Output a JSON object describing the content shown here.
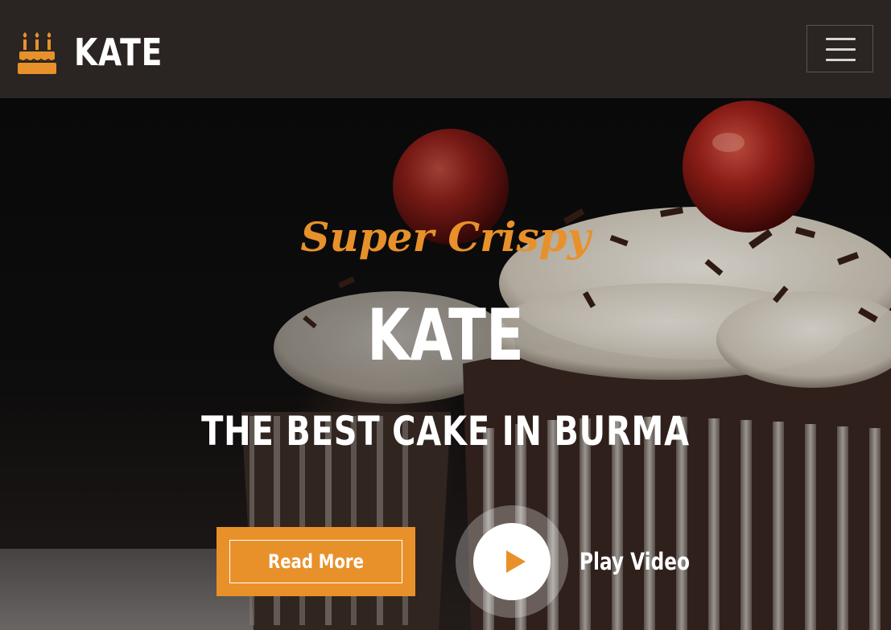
{
  "brand": {
    "name": "KATE",
    "icon": "birthday-cake-icon",
    "accent": "#e8912a"
  },
  "navbar": {
    "menu_icon": "hamburger-menu-icon",
    "background": "#2a2523"
  },
  "hero": {
    "subtitle": "Super Crispy",
    "title": "KATE",
    "tagline": "THE BEST CAKE IN BURMA",
    "read_more_label": "Read More",
    "play_video_label": "Play Video",
    "play_icon": "play-icon",
    "accent": "#e8912a"
  }
}
